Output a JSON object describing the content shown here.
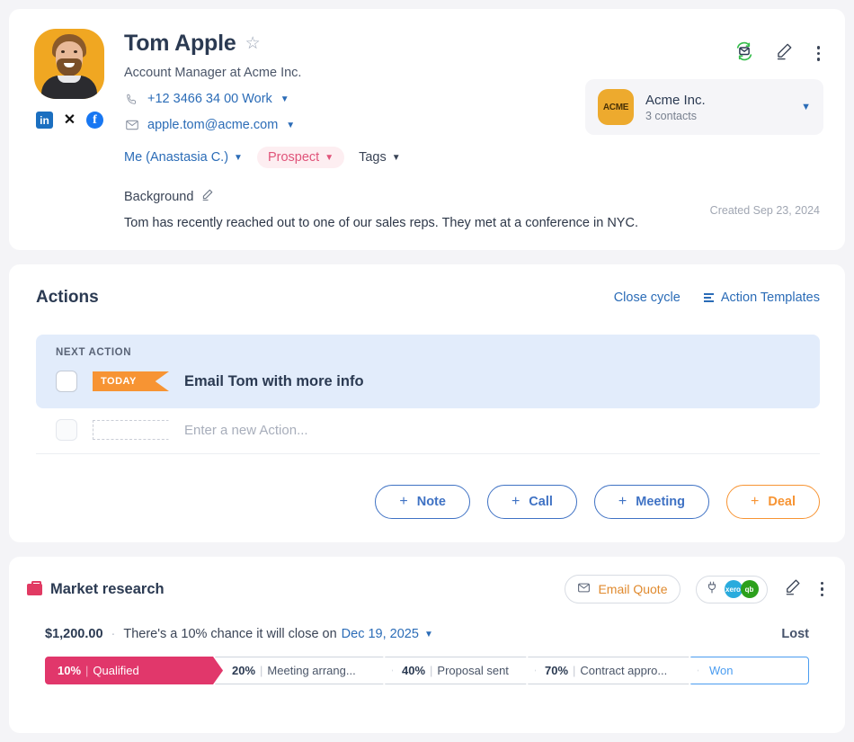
{
  "contact": {
    "name": "Tom Apple",
    "favorite_icon": "star-icon",
    "subtitle": "Account Manager at Acme Inc.",
    "phone": "+12 3466 34 00 Work",
    "email": "apple.tom@acme.com",
    "owner": "Me (Anastasia C.)",
    "status_tag": "Prospect",
    "tags_label": "Tags",
    "socials": [
      "linkedin-icon",
      "x-icon",
      "facebook-icon"
    ],
    "avatar_alt": "contact-photo",
    "background": {
      "title": "Background",
      "text": "Tom has recently reached out to one of our sales reps. They met at a conference in NYC.",
      "created": "Created Sep 23, 2024"
    },
    "top_icons": [
      "email-sync-icon",
      "edit-pencil-icon",
      "more-menu-icon"
    ],
    "company": {
      "logo_text": "ACME",
      "name": "Acme Inc.",
      "contacts": "3 contacts"
    }
  },
  "actions": {
    "title": "Actions",
    "close_cycle": "Close cycle",
    "templates": "Action Templates",
    "next_label": "NEXT ACTION",
    "next_badge": "TODAY",
    "next_task": "Email Tom with more info",
    "new_placeholder": "Enter a new Action...",
    "buttons": [
      {
        "label": "Note",
        "plus": "+"
      },
      {
        "label": "Call",
        "plus": "+"
      },
      {
        "label": "Meeting",
        "plus": "+"
      },
      {
        "label": "Deal",
        "plus": "+"
      }
    ]
  },
  "deal": {
    "title": "Market research",
    "email_quote": "Email Quote",
    "integrations": [
      {
        "name": "xero-badge",
        "label": "xero"
      },
      {
        "name": "quickbooks-badge",
        "label": "qb"
      }
    ],
    "amount": "$1,200.00",
    "separator": "·",
    "chance_prefix": "There's a 10% chance it will close on",
    "close_date": "Dec 19, 2025",
    "lost_label": "Lost",
    "stages": [
      {
        "pct": "10%",
        "bar": "|",
        "name": "Qualified",
        "active": true
      },
      {
        "pct": "20%",
        "bar": "|",
        "name": "Meeting arrang...",
        "active": false
      },
      {
        "pct": "40%",
        "bar": "|",
        "name": "Proposal sent",
        "active": false
      },
      {
        "pct": "70%",
        "bar": "|",
        "name": "Contract appro...",
        "active": false
      },
      {
        "pct": "",
        "bar": "",
        "name": "Won",
        "active": false
      }
    ]
  },
  "colors": {
    "page_bg": "#f4f4f7",
    "accent_blue": "#2b6cb7",
    "accent_orange": "#f79433",
    "accent_pink": "#e1376b",
    "won_blue": "#4a9cf0"
  }
}
